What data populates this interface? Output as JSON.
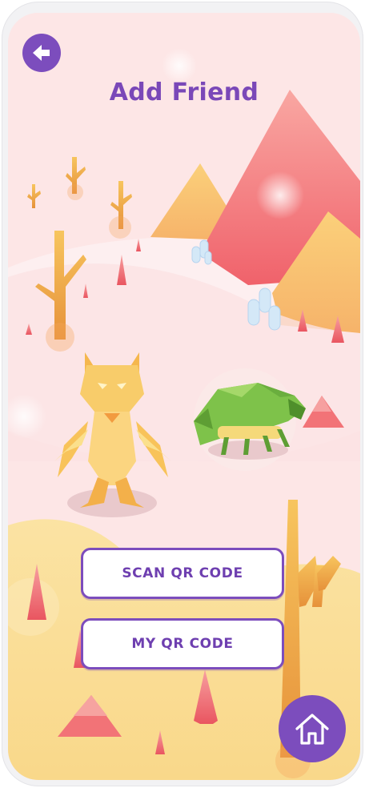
{
  "header": {
    "title": "Add Friend"
  },
  "actions": {
    "scan_label": "SCAN QR CODE",
    "my_label": "MY QR CODE"
  },
  "icons": {
    "back": "arrow-left-icon",
    "home": "home-icon"
  },
  "colors": {
    "accent": "#7c4dbd",
    "background": "#fde7e7",
    "title": "#7a48b8"
  }
}
